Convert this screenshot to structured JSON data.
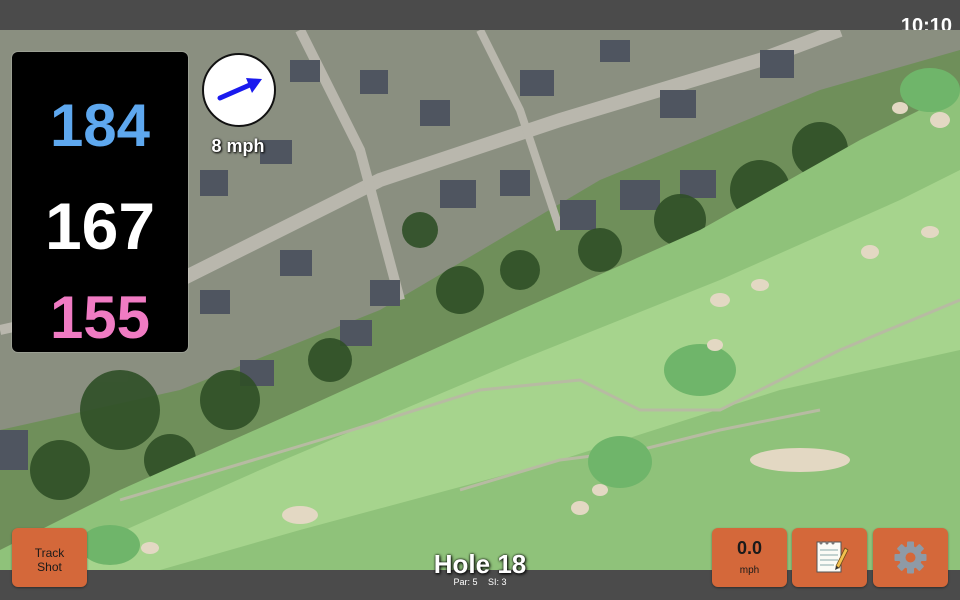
{
  "status": {
    "clock": "10:10"
  },
  "distances": {
    "back": {
      "value": "184",
      "color": "#5ea8ef"
    },
    "middle": {
      "value": "167",
      "color": "#ffffff"
    },
    "front": {
      "value": "155",
      "color": "#f07bc3"
    }
  },
  "wind": {
    "label": "8 mph",
    "icon": "wind-arrow-icon",
    "arrow_color": "#1a1aee",
    "label_color": "#c41fb0"
  },
  "buttons": {
    "track_shot_line1": "Track",
    "track_shot_line2": "Shot",
    "speed_value": "0.0",
    "speed_unit": "mph",
    "notes_icon": "notepad-icon",
    "settings_icon": "gear-icon"
  },
  "hole": {
    "title": "Hole 18",
    "par": "Par: 5",
    "si": "SI: 3"
  },
  "colors": {
    "button": "#d4683a",
    "bar": "#4b4b4b"
  }
}
